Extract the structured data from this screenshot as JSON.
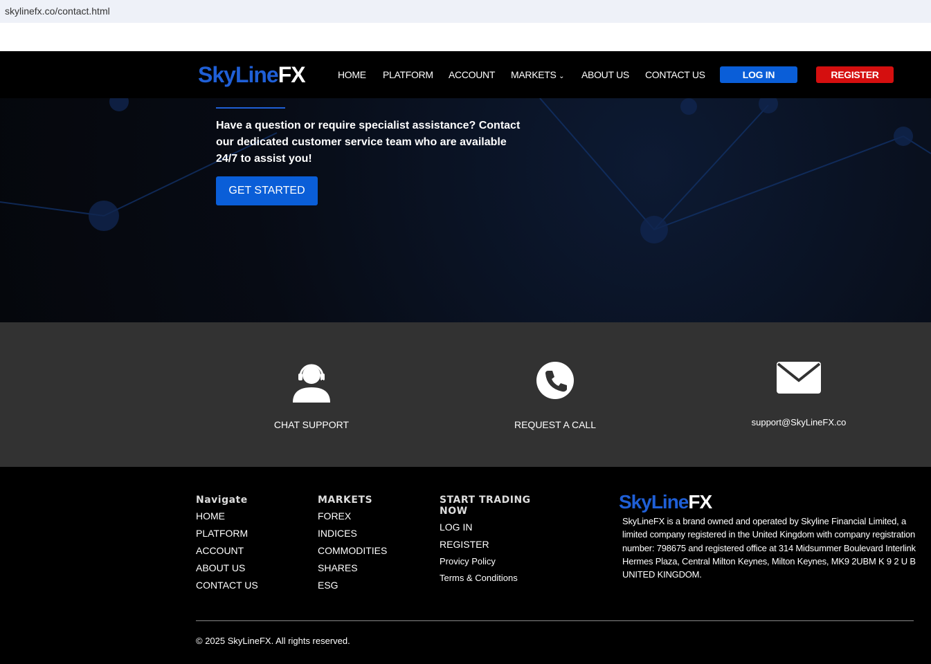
{
  "browser": {
    "url": "skylinefx.co/contact.html"
  },
  "logo": {
    "part1": "SkyLine",
    "part2": "FX"
  },
  "nav": {
    "items": [
      "HOME",
      "PLATFORM",
      "ACCOUNT",
      "MARKETS",
      "ABOUT US",
      "CONTACT US"
    ],
    "login": "LOG IN",
    "register": "REGISTER"
  },
  "hero": {
    "text": "Have a question or require specialist assistance? Contact our dedicated customer service team who are available 24/7 to assist you!",
    "button": "GET STARTED"
  },
  "contact": {
    "chat": "CHAT SUPPORT",
    "call": "REQUEST A CALL",
    "email": "support@SkyLineFX.co"
  },
  "footer": {
    "navigate": {
      "title": "Navigate",
      "items": [
        "HOME",
        "PLATFORM",
        "ACCOUNT",
        "ABOUT US",
        "CONTACT US"
      ]
    },
    "markets": {
      "title": "MARKETS",
      "items": [
        "FOREX",
        "INDICES",
        "COMMODITIES",
        "SHARES",
        "ESG"
      ]
    },
    "trading": {
      "title": "START TRADING NOW",
      "items": [
        "LOG IN",
        "REGISTER",
        "Provicy Policy",
        "Terms & Conditions"
      ]
    },
    "about": "SkyLineFX is a brand owned and operated by Skyline Financial Limited, a limited company registered in the United Kingdom with company registration number: 798675 and registered office at 314 Midsummer Boulevard Interlink Hermes Plaza, Central Milton Keynes, Milton Keynes, MK9 2UBM K 9 2 U B UNITED KINGDOM.",
    "copyright": "© 2025 SkyLineFX. All rights reserved."
  },
  "colors": {
    "brand": "#1f5fd6",
    "login": "#0a5ed8",
    "register": "#d50f0f"
  }
}
